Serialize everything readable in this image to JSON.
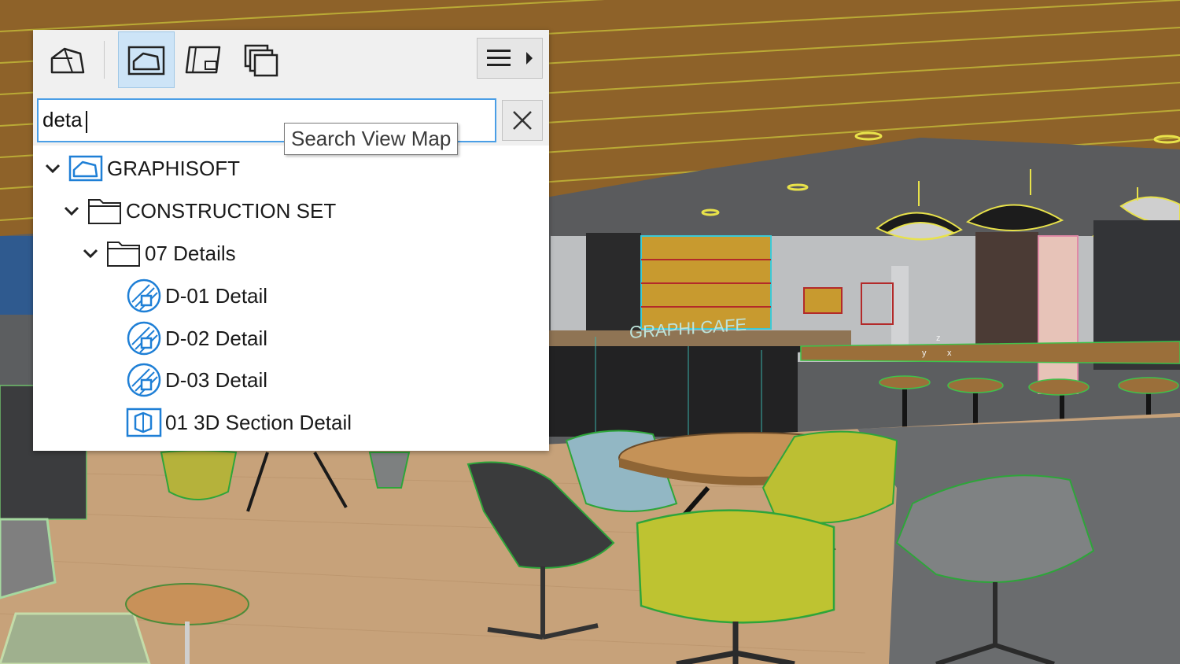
{
  "toolbar": {
    "buttons": [
      {
        "name": "project-map-icon",
        "active": false
      },
      {
        "name": "view-map-icon",
        "active": true
      },
      {
        "name": "layout-book-icon",
        "active": false
      },
      {
        "name": "publisher-sets-icon",
        "active": false
      }
    ],
    "menu_icon": "hamburger-menu-icon",
    "menu_arrow_icon": "triangle-right-icon"
  },
  "search": {
    "value": "deta",
    "tooltip": "Search View Map",
    "clear_icon": "close-icon"
  },
  "tree": {
    "root": {
      "label": "GRAPHISOFT",
      "icon": "view-map-icon",
      "expanded": true
    },
    "folder": {
      "label": "CONSTRUCTION SET",
      "icon": "folder-icon",
      "expanded": true
    },
    "subfolder": {
      "label": "07 Details",
      "icon": "folder-icon",
      "expanded": true
    },
    "items": [
      {
        "label": "D-01 Detail",
        "icon": "detail-view-icon"
      },
      {
        "label": "D-02 Detail",
        "icon": "detail-view-icon"
      },
      {
        "label": "D-03 Detail",
        "icon": "detail-view-icon"
      },
      {
        "label": "01 3D Section Detail",
        "icon": "3d-section-icon"
      }
    ]
  },
  "scene": {
    "sign_text": "GRAPHI CAFE",
    "axis_labels": {
      "z": "z",
      "y": "y",
      "x": "x"
    }
  },
  "colors": {
    "accent": "#1e7fd6",
    "selection": "#cde4f7",
    "search_border": "#4a9ee6",
    "floor": "#c9a57c",
    "ceiling_wood": "#9a6a2c",
    "chair_yellow": "#c4c43a",
    "chair_gray": "#7d8080",
    "chair_blue": "#8fb2bf"
  }
}
